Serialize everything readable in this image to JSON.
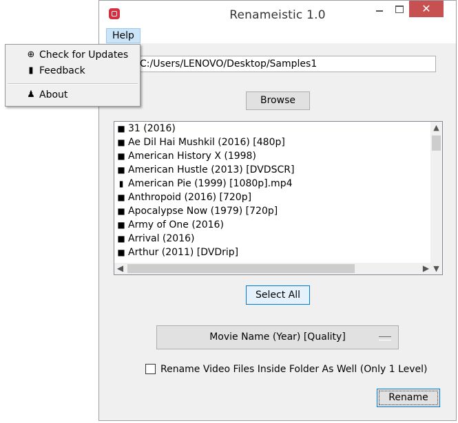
{
  "window": {
    "title": "Renameistic 1.0",
    "minimize_icon": "minimize-icon",
    "maximize_icon": "maximize-icon",
    "close_glyph": "✕"
  },
  "menubar": {
    "help_label": "Help"
  },
  "help_menu": {
    "items": [
      {
        "label": "Check for Updates",
        "icon": "globe-icon"
      },
      {
        "label": "Feedback",
        "icon": "bookmark-icon"
      },
      {
        "label": "About",
        "icon": "user-icon"
      }
    ]
  },
  "path": {
    "value": "C:/Users/LENOVO/Desktop/Samples1"
  },
  "browse_label": "Browse",
  "file_list": {
    "items": [
      {
        "label": "31 (2016)",
        "type": "folder"
      },
      {
        "label": "Ae Dil Hai Mushkil (2016) [480p]",
        "type": "folder"
      },
      {
        "label": "American History X (1998)",
        "type": "folder"
      },
      {
        "label": "American Hustle (2013) [DVDSCR]",
        "type": "folder"
      },
      {
        "label": "American Pie (1999) [1080p].mp4",
        "type": "file"
      },
      {
        "label": "Anthropoid (2016) [720p]",
        "type": "folder"
      },
      {
        "label": "Apocalypse Now (1979) [720p]",
        "type": "folder"
      },
      {
        "label": "Army of One (2016)",
        "type": "folder"
      },
      {
        "label": "Arrival (2016)",
        "type": "folder"
      },
      {
        "label": "Arthur (2011) [DVDrip]",
        "type": "folder"
      }
    ]
  },
  "select_all_label": "Select All",
  "format_dropdown": {
    "selected": "Movie Name (Year) [Quality]"
  },
  "checkbox": {
    "label": "Rename Video Files Inside Folder As Well (Only 1 Level)",
    "checked": false
  },
  "rename_label": "Rename",
  "colors": {
    "accent": "#0078d7",
    "close_button": "#c75050",
    "app_icon": "#d32f3f"
  }
}
